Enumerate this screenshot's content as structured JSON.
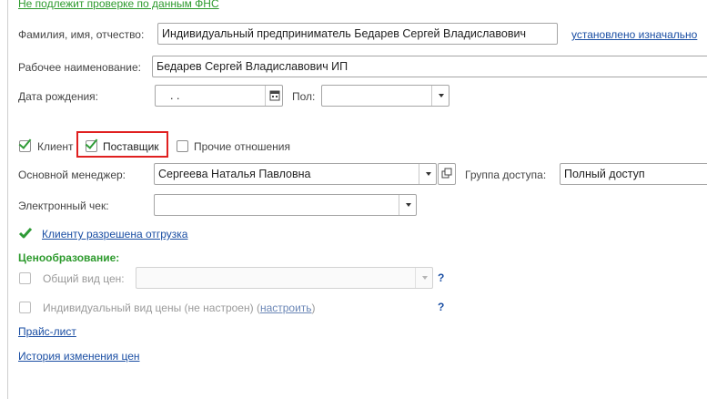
{
  "links": {
    "fns_check": "Не подлежит проверке по данным ФНС",
    "set_initially": "установлено изначально",
    "shipment_allowed": "Клиенту разрешена отгрузка",
    "configure": "настроить",
    "price_list": "Прайс-лист",
    "price_history": "История изменения цен"
  },
  "form": {
    "fio_label": "Фамилия, имя, отчество:",
    "fio_value": "Индивидуальный предприниматель Бедарев Сергей Владиславович",
    "work_name_label": "Рабочее наименование:",
    "work_name_value": "Бедарев Сергей Владиславович ИП",
    "birth_label": "Дата рождения:",
    "birth_value": " .  .",
    "gender_label": "Пол:",
    "gender_value": "",
    "manager_label": "Основной менеджер:",
    "manager_value": "Сергеева Наталья Павловна",
    "access_group_label": "Группа доступа:",
    "access_group_value": "Полный доступ",
    "echeck_label": "Электронный чек:",
    "echeck_value": ""
  },
  "relations": {
    "client": {
      "label": "Клиент",
      "checked": true
    },
    "supplier": {
      "label": "Поставщик",
      "checked": true,
      "highlighted": true
    },
    "other": {
      "label": "Прочие отношения",
      "checked": false
    }
  },
  "pricing": {
    "section_title": "Ценообразование:",
    "general_price_label": "Общий вид цен:",
    "general_price_value": "",
    "general_price_checked": false,
    "individual_price_label": "Индивидуальный вид цены (не настроен) (",
    "individual_price_close": ")",
    "individual_price_checked": false,
    "help": "?"
  },
  "colors": {
    "link": "#1a4ea3",
    "green": "#2d9a2d",
    "highlight": "#e02020"
  }
}
